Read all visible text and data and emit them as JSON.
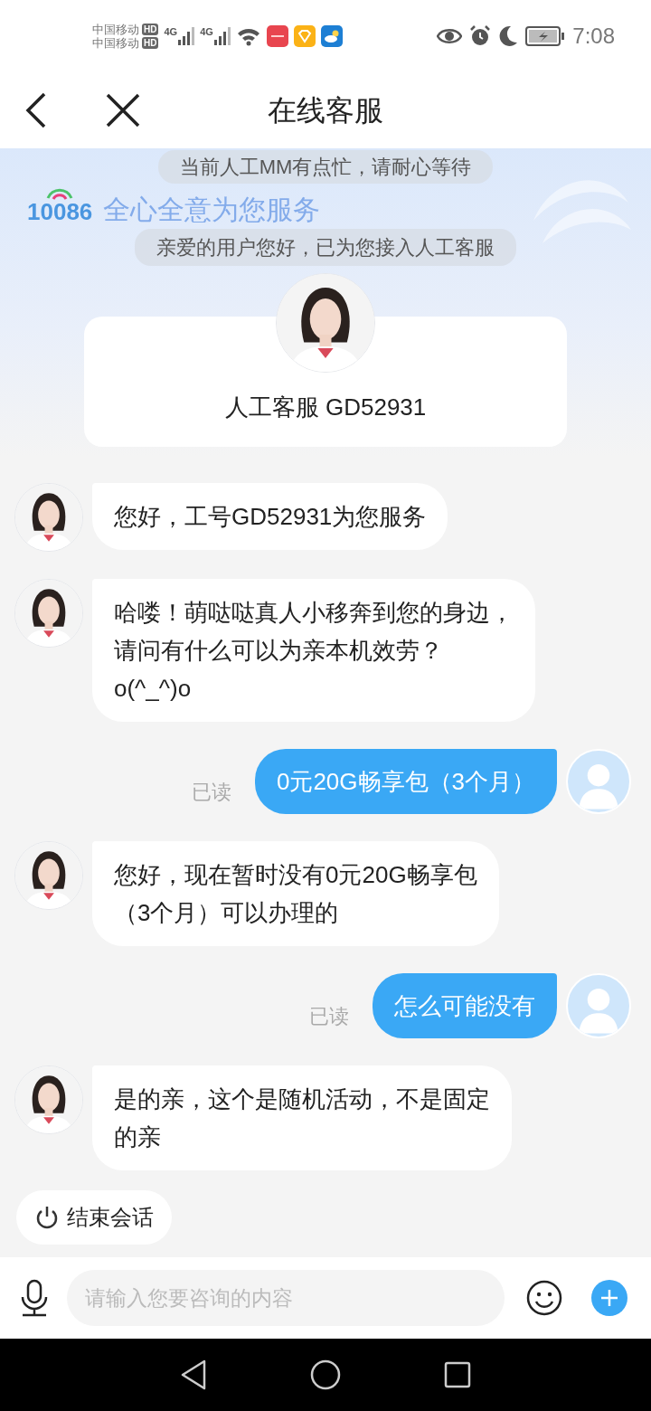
{
  "status_bar": {
    "carriers": [
      {
        "name": "中国移动",
        "badge": "HD"
      },
      {
        "name": "中国移动",
        "badge": "HD"
      }
    ],
    "networks": [
      "4G",
      "4G"
    ],
    "time": "7:08"
  },
  "header": {
    "title": "在线客服"
  },
  "banner": {
    "logo": "10086",
    "slogan": "全心全意为您服务"
  },
  "notices": [
    "当前人工MM有点忙，请耐心等待",
    "亲爱的用户您好，已为您接入人工客服"
  ],
  "agent_card": {
    "name": "人工客服 GD52931"
  },
  "messages": [
    {
      "kind": "agent",
      "lines": [
        "您好，工号GD52931为您服务"
      ]
    },
    {
      "kind": "agent",
      "lines": [
        "哈喽！萌哒哒真人小移奔到您的身边，",
        "请问有什么可以为亲本机效劳？",
        "o(^_^)o"
      ]
    },
    {
      "kind": "user",
      "lines": [
        "0元20G畅享包（3个月）"
      ],
      "receipt": "已读"
    },
    {
      "kind": "agent",
      "lines": [
        "您好，现在暂时没有0元20G畅享包",
        "（3个月）可以办理的"
      ]
    },
    {
      "kind": "user",
      "lines": [
        "怎么可能没有"
      ],
      "receipt": "已读"
    },
    {
      "kind": "agent",
      "lines": [
        "是的亲，这个是随机活动，不是固定",
        "的亲"
      ]
    }
  ],
  "end_button": "结束会话",
  "input": {
    "placeholder": "请输入您要咨询的内容"
  }
}
